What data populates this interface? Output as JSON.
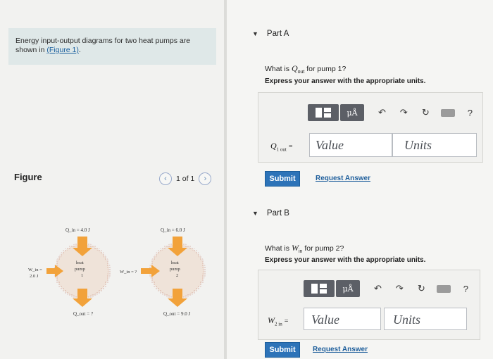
{
  "problem": {
    "intro_text": "Energy input-output diagrams for two heat pumps are shown in",
    "figure_link": "(Figure 1)",
    "intro_end": "."
  },
  "figure": {
    "label": "Figure",
    "pager_text": "1 of 1",
    "prev_icon": "chevron-left-icon",
    "next_icon": "chevron-right-icon",
    "pump1": {
      "qin": "Q_in = 4.0 J",
      "win": "W_in = 2.0 J",
      "qout": "Q_out = ?",
      "name": "heat pump 1"
    },
    "pump2": {
      "qin": "Q_in = 6.0 J",
      "win": "W_in = ?",
      "qout": "Q_out = 9.0 J",
      "name": "heat pump 2"
    },
    "colors": {
      "circle_fill": "#efe3d9",
      "circle_border": "#c98a7a",
      "arrow": "#f2a23a"
    }
  },
  "partA": {
    "title": "Part A",
    "question_pre": "What is",
    "question_var": "Q",
    "question_sub": "out",
    "question_post": "for pump 1?",
    "instruction": "Express your answer with the appropriate units.",
    "var_label": "Q",
    "var_sub": "1 out",
    "equals": "=",
    "value_placeholder": "Value",
    "units_placeholder": "Units",
    "submit_label": "Submit",
    "request_label": "Request Answer"
  },
  "partB": {
    "title": "Part B",
    "question_pre": "What is",
    "question_var": "W",
    "question_sub": "in",
    "question_post": "for pump 2?",
    "instruction": "Express your answer with the appropriate units.",
    "var_label": "W",
    "var_sub": "2 in",
    "equals": "=",
    "value_placeholder": "Value",
    "units_placeholder": "Units",
    "submit_label": "Submit",
    "request_label": "Request Answer"
  },
  "toolbar": {
    "mu_label": "μÅ",
    "help": "?",
    "icons": [
      "templates-icon",
      "units-mu-icon",
      "undo-icon",
      "redo-icon",
      "reset-icon",
      "keyboard-icon",
      "help-icon"
    ]
  }
}
